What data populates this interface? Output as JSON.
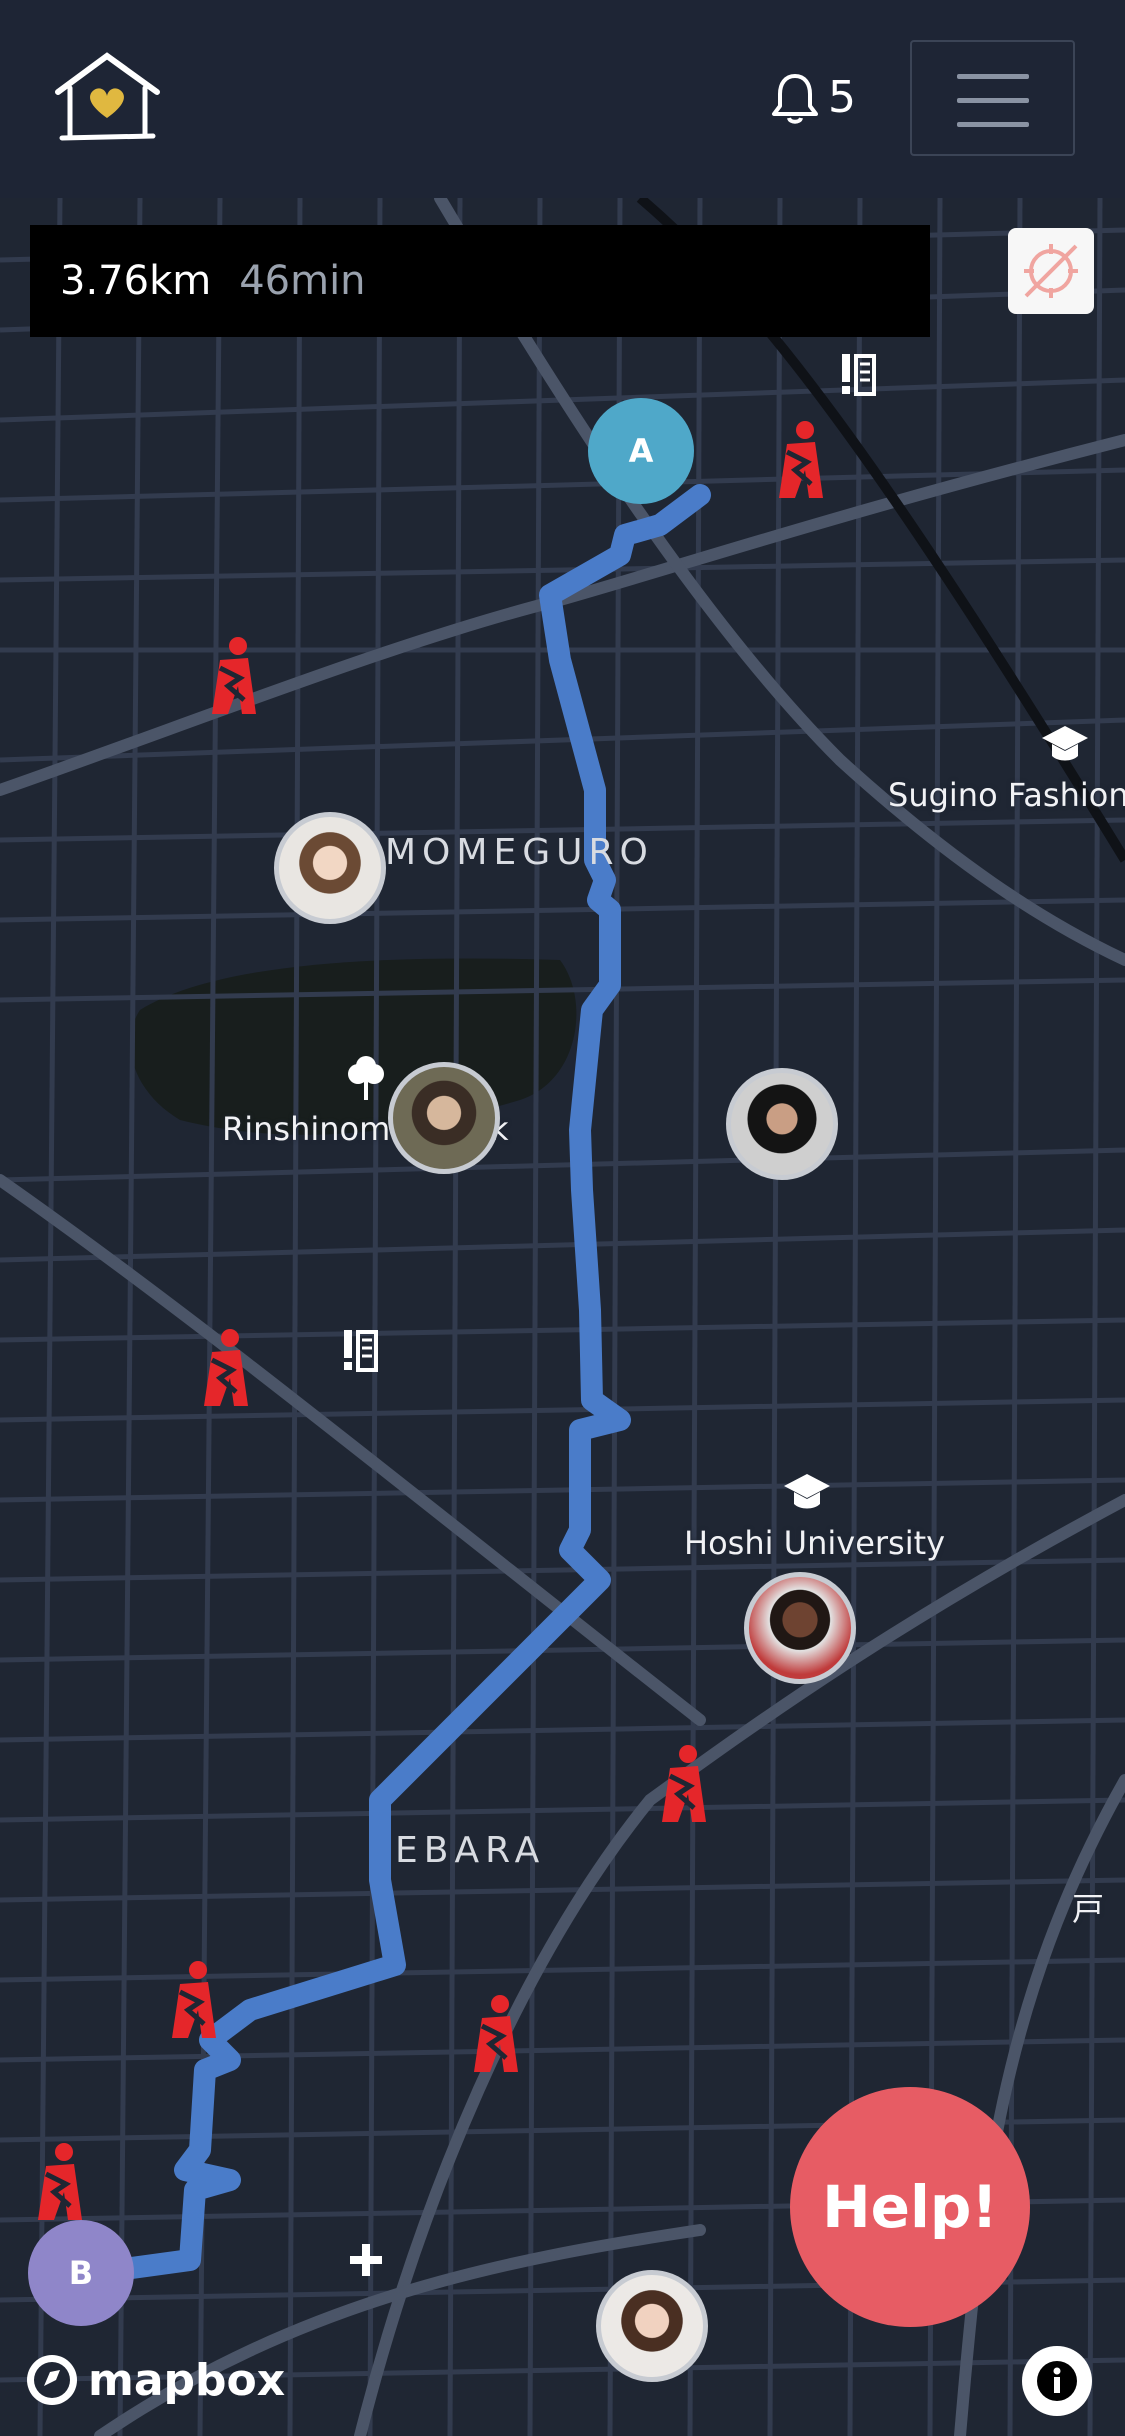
{
  "header": {
    "notification_count": "5",
    "icons": {
      "logo": "home-heart-logo",
      "bell": "bell-icon",
      "menu": "hamburger-menu-icon"
    }
  },
  "route": {
    "distance": "3.76km",
    "duration": "46min",
    "start_label": "A",
    "end_label": "B"
  },
  "map": {
    "districts": [
      "MOMEGURO",
      "EBARA"
    ],
    "pois": [
      "Sugino Fashion",
      "Rinshinom",
      "k",
      "Hoshi University"
    ],
    "partial_text": "戸",
    "icons": [
      "compass-off-icon",
      "alert-person-icon",
      "school-icon",
      "museum-icon",
      "park-icon",
      "hospital-cross-icon",
      "info-icon"
    ]
  },
  "help_button": {
    "label": "Help!"
  },
  "attribution": {
    "label": "mapbox"
  },
  "colors": {
    "route": "#4a7cc9",
    "marker_a": "#4fa8c9",
    "marker_b": "#8f86c9",
    "help": "#e75c64",
    "alert": "#e5262a"
  }
}
